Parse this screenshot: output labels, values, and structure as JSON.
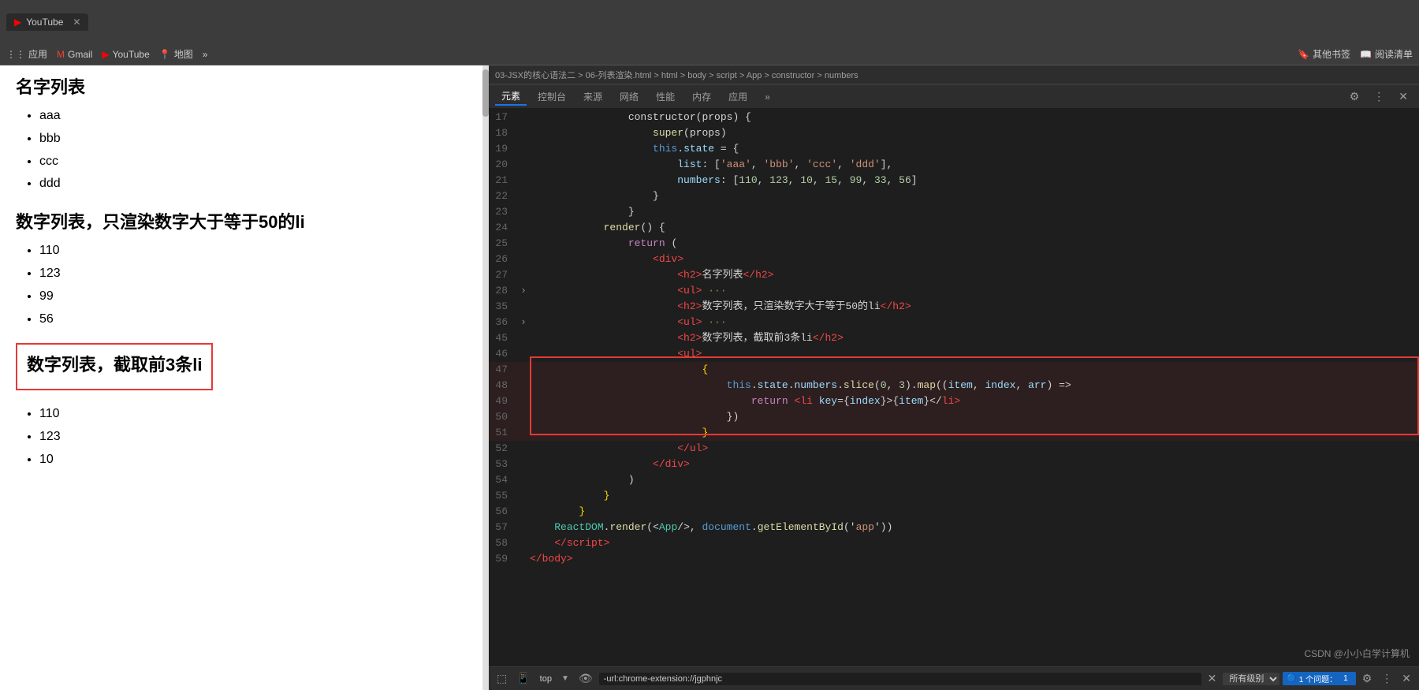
{
  "browser": {
    "tab_title": "YouTube",
    "bookmarks": [
      "应用",
      "Gmail",
      "YouTube",
      "地图",
      "»",
      "其他书签",
      "阅读清单"
    ]
  },
  "left_panel": {
    "section1_title": "名字列表",
    "section1_items": [
      "aaa",
      "bbb",
      "ccc",
      "ddd"
    ],
    "section2_title": "数字列表，只渲染数字大于等于50的li",
    "section2_items": [
      "110",
      "123",
      "99",
      "56"
    ],
    "section3_title": "数字列表，截取前3条li",
    "section3_items": [
      "110",
      "123",
      "10"
    ]
  },
  "devtools": {
    "breadcrumb": "03-JSX的核心语法二 > 06-列表渲染.html > html > body > script > App > constructor > numbers",
    "tabs": [
      "元素",
      "控制台",
      "来源",
      "网络",
      "性能",
      "内存",
      "应用",
      "»"
    ],
    "console_filter": "top",
    "console_input": "-url:chrome-extension://jgphnjc",
    "console_select": "所有级别",
    "issues_badge": "1",
    "issues_count": "1 个问题：",
    "csdn_watermark": "CSDN @小小白学计算机"
  },
  "code": {
    "lines": [
      {
        "num": 17,
        "indent": 16,
        "tokens": [
          {
            "t": "constructor(props) {",
            "c": "white"
          }
        ]
      },
      {
        "num": 18,
        "indent": 20,
        "tokens": [
          {
            "t": "super(props)",
            "c": "white"
          }
        ]
      },
      {
        "num": 19,
        "indent": 20,
        "tokens": [
          {
            "t": "this",
            "c": "kw2"
          },
          {
            "t": ".",
            "c": "white"
          },
          {
            "t": "state",
            "c": "prop"
          },
          {
            "t": " = {",
            "c": "white"
          }
        ]
      },
      {
        "num": 20,
        "indent": 24,
        "tokens": [
          {
            "t": "list",
            "c": "prop"
          },
          {
            "t": ": [",
            "c": "white"
          },
          {
            "t": "'aaa'",
            "c": "str"
          },
          {
            "t": ", ",
            "c": "white"
          },
          {
            "t": "'bbb'",
            "c": "str"
          },
          {
            "t": ", ",
            "c": "white"
          },
          {
            "t": "'ccc'",
            "c": "str"
          },
          {
            "t": ", ",
            "c": "white"
          },
          {
            "t": "'ddd'",
            "c": "str"
          },
          {
            "t": "],",
            "c": "white"
          }
        ]
      },
      {
        "num": 21,
        "indent": 24,
        "tokens": [
          {
            "t": "numbers",
            "c": "prop"
          },
          {
            "t": ": [",
            "c": "white"
          },
          {
            "t": "110",
            "c": "num"
          },
          {
            "t": ", ",
            "c": "white"
          },
          {
            "t": "123",
            "c": "num"
          },
          {
            "t": ", ",
            "c": "white"
          },
          {
            "t": "10",
            "c": "num"
          },
          {
            "t": ", ",
            "c": "white"
          },
          {
            "t": "15",
            "c": "num"
          },
          {
            "t": ", ",
            "c": "white"
          },
          {
            "t": "99",
            "c": "num"
          },
          {
            "t": ", ",
            "c": "white"
          },
          {
            "t": "33",
            "c": "num"
          },
          {
            "t": ", ",
            "c": "white"
          },
          {
            "t": "56",
            "c": "num"
          },
          {
            "t": "]",
            "c": "white"
          }
        ]
      },
      {
        "num": 22,
        "indent": 20,
        "tokens": [
          {
            "t": "}",
            "c": "white"
          }
        ]
      },
      {
        "num": 23,
        "indent": 16,
        "tokens": [
          {
            "t": "}",
            "c": "white"
          }
        ]
      },
      {
        "num": 24,
        "indent": 12,
        "tokens": [
          {
            "t": "render() {",
            "c": "white"
          }
        ]
      },
      {
        "num": 25,
        "indent": 16,
        "tokens": [
          {
            "t": "return (",
            "c": "kw"
          }
        ]
      },
      {
        "num": 26,
        "indent": 20,
        "tokens": [
          {
            "t": "<",
            "c": "red-text"
          },
          {
            "t": "div",
            "c": "red-text"
          },
          {
            "t": ">",
            "c": "red-text"
          }
        ]
      },
      {
        "num": 27,
        "indent": 24,
        "tokens": [
          {
            "t": "<",
            "c": "red-text"
          },
          {
            "t": "h2",
            "c": "red-text"
          },
          {
            "t": ">",
            "c": "red-text"
          },
          {
            "t": "名字列表",
            "c": "white"
          },
          {
            "t": "</",
            "c": "red-text"
          },
          {
            "t": "h2",
            "c": "red-text"
          },
          {
            "t": ">",
            "c": "red-text"
          }
        ]
      },
      {
        "num": 28,
        "indent": 24,
        "arrow": "›",
        "tokens": [
          {
            "t": "<",
            "c": "red-text"
          },
          {
            "t": "ul",
            "c": "red-text"
          },
          {
            "t": ">",
            "c": "red-text"
          },
          {
            "t": " ···",
            "c": "comment"
          }
        ]
      },
      {
        "num": 35,
        "indent": 24,
        "tokens": [
          {
            "t": "<",
            "c": "red-text"
          },
          {
            "t": "h2",
            "c": "red-text"
          },
          {
            "t": ">",
            "c": "red-text"
          },
          {
            "t": "数字列表，只渲染数字大于等于50的li",
            "c": "white"
          },
          {
            "t": "</",
            "c": "red-text"
          },
          {
            "t": "h2",
            "c": "red-text"
          },
          {
            "t": ">",
            "c": "red-text"
          }
        ]
      },
      {
        "num": 36,
        "indent": 24,
        "arrow": "›",
        "tokens": [
          {
            "t": "<",
            "c": "red-text"
          },
          {
            "t": "ul",
            "c": "red-text"
          },
          {
            "t": ">",
            "c": "red-text"
          },
          {
            "t": " ···",
            "c": "comment"
          }
        ]
      },
      {
        "num": 45,
        "indent": 24,
        "tokens": [
          {
            "t": "<",
            "c": "red-text"
          },
          {
            "t": "h2",
            "c": "red-text"
          },
          {
            "t": ">",
            "c": "red-text"
          },
          {
            "t": "数字列表，截取前3条li",
            "c": "white"
          },
          {
            "t": "</",
            "c": "red-text"
          },
          {
            "t": "h2",
            "c": "red-text"
          },
          {
            "t": ">",
            "c": "red-text"
          }
        ]
      },
      {
        "num": 46,
        "indent": 24,
        "tokens": [
          {
            "t": "<",
            "c": "red-text"
          },
          {
            "t": "ul",
            "c": "red-text"
          },
          {
            "t": ">",
            "c": "red-text"
          }
        ]
      },
      {
        "num": 47,
        "indent": 28,
        "tokens": [
          {
            "t": "{",
            "c": "bracket-yellow"
          }
        ],
        "highlight_start": true
      },
      {
        "num": 48,
        "indent": 32,
        "tokens": [
          {
            "t": "this",
            "c": "kw2"
          },
          {
            "t": ".",
            "c": "white"
          },
          {
            "t": "state",
            "c": "prop"
          },
          {
            "t": ".",
            "c": "white"
          },
          {
            "t": "numbers",
            "c": "prop"
          },
          {
            "t": ".",
            "c": "white"
          },
          {
            "t": "slice",
            "c": "fn"
          },
          {
            "t": "(",
            "c": "white"
          },
          {
            "t": "0",
            "c": "num"
          },
          {
            "t": ", ",
            "c": "white"
          },
          {
            "t": "3",
            "c": "num"
          },
          {
            "t": ").",
            "c": "white"
          },
          {
            "t": "map",
            "c": "fn"
          },
          {
            "t": "((",
            "c": "white"
          },
          {
            "t": "item",
            "c": "prop"
          },
          {
            "t": ", ",
            "c": "white"
          },
          {
            "t": "index",
            "c": "prop"
          },
          {
            "t": ", ",
            "c": "white"
          },
          {
            "t": "arr",
            "c": "prop"
          },
          {
            "t": ") =>",
            "c": "white"
          }
        ]
      },
      {
        "num": 49,
        "indent": 36,
        "tokens": [
          {
            "t": "return ",
            "c": "kw"
          },
          {
            "t": "<",
            "c": "red-text"
          },
          {
            "t": "li",
            "c": "red-text"
          },
          {
            "t": " ",
            "c": "white"
          },
          {
            "t": "key",
            "c": "prop"
          },
          {
            "t": "={",
            "c": "white"
          },
          {
            "t": "index",
            "c": "prop"
          },
          {
            "t": "}>{",
            "c": "white"
          },
          {
            "t": "item",
            "c": "prop"
          },
          {
            "t": "}</",
            "c": "white"
          },
          {
            "t": "li",
            "c": "red-text"
          },
          {
            "t": ">",
            "c": "red-text"
          }
        ]
      },
      {
        "num": 50,
        "indent": 32,
        "tokens": [
          {
            "t": "})",
            "c": "white"
          }
        ]
      },
      {
        "num": 51,
        "indent": 28,
        "tokens": [
          {
            "t": "}",
            "c": "bracket-yellow"
          }
        ],
        "highlight_end": true
      },
      {
        "num": 52,
        "indent": 24,
        "tokens": [
          {
            "t": "</",
            "c": "red-text"
          },
          {
            "t": "ul",
            "c": "red-text"
          },
          {
            "t": ">",
            "c": "red-text"
          }
        ]
      },
      {
        "num": 53,
        "indent": 20,
        "tokens": [
          {
            "t": "</",
            "c": "red-text"
          },
          {
            "t": "div",
            "c": "red-text"
          },
          {
            "t": ">",
            "c": "red-text"
          }
        ]
      },
      {
        "num": 54,
        "indent": 16,
        "tokens": [
          {
            "t": ")",
            "c": "white"
          }
        ]
      },
      {
        "num": 55,
        "indent": 12,
        "tokens": [
          {
            "t": "}",
            "c": "bracket-yellow"
          }
        ]
      },
      {
        "num": 56,
        "indent": 8,
        "tokens": [
          {
            "t": "}",
            "c": "bracket-yellow"
          }
        ]
      },
      {
        "num": 57,
        "indent": 4,
        "tokens": [
          {
            "t": "ReactDOM",
            "c": "teal"
          },
          {
            "t": ".",
            "c": "white"
          },
          {
            "t": "render",
            "c": "fn"
          },
          {
            "t": "(<",
            "c": "white"
          },
          {
            "t": "App",
            "c": "teal"
          },
          {
            "t": "/>, ",
            "c": "white"
          },
          {
            "t": "document",
            "c": "kw2"
          },
          {
            "t": ".",
            "c": "white"
          },
          {
            "t": "getElementById",
            "c": "fn"
          },
          {
            "t": "('",
            "c": "white"
          },
          {
            "t": "app",
            "c": "str"
          },
          {
            "t": "'))",
            "c": "white"
          }
        ]
      },
      {
        "num": 58,
        "indent": 4,
        "tokens": [
          {
            "t": "</",
            "c": "red-text"
          },
          {
            "t": "script",
            "c": "red-text"
          },
          {
            "t": ">",
            "c": "red-text"
          }
        ]
      },
      {
        "num": 59,
        "indent": 0,
        "tokens": [
          {
            "t": "</",
            "c": "red-text"
          },
          {
            "t": "body",
            "c": "red-text"
          },
          {
            "t": ">",
            "c": "red-text"
          }
        ]
      }
    ]
  }
}
